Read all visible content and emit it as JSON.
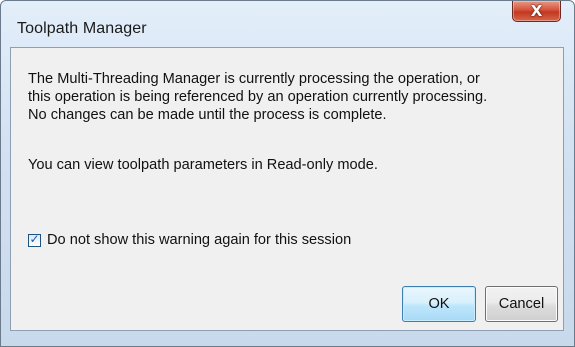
{
  "window": {
    "title": "Toolpath Manager",
    "close_symbol": "X",
    "close_icon": "close-icon"
  },
  "message": {
    "lines": [
      "The Multi-Threading Manager is currently processing the operation, or",
      "this operation is being referenced by an operation currently processing.",
      "No changes can be made until the process is complete."
    ],
    "info": "You can view toolpath parameters in Read-only mode."
  },
  "checkbox": {
    "label": "Do not show this warning again for this session",
    "checked": true,
    "check_symbol": "✓"
  },
  "buttons": {
    "ok_label": "OK",
    "cancel_label": "Cancel"
  },
  "colors": {
    "close_button": "#d5533b",
    "ok_border": "#3c7fb1",
    "frame": "#d3e2f2",
    "client": "#f0f0f0"
  }
}
